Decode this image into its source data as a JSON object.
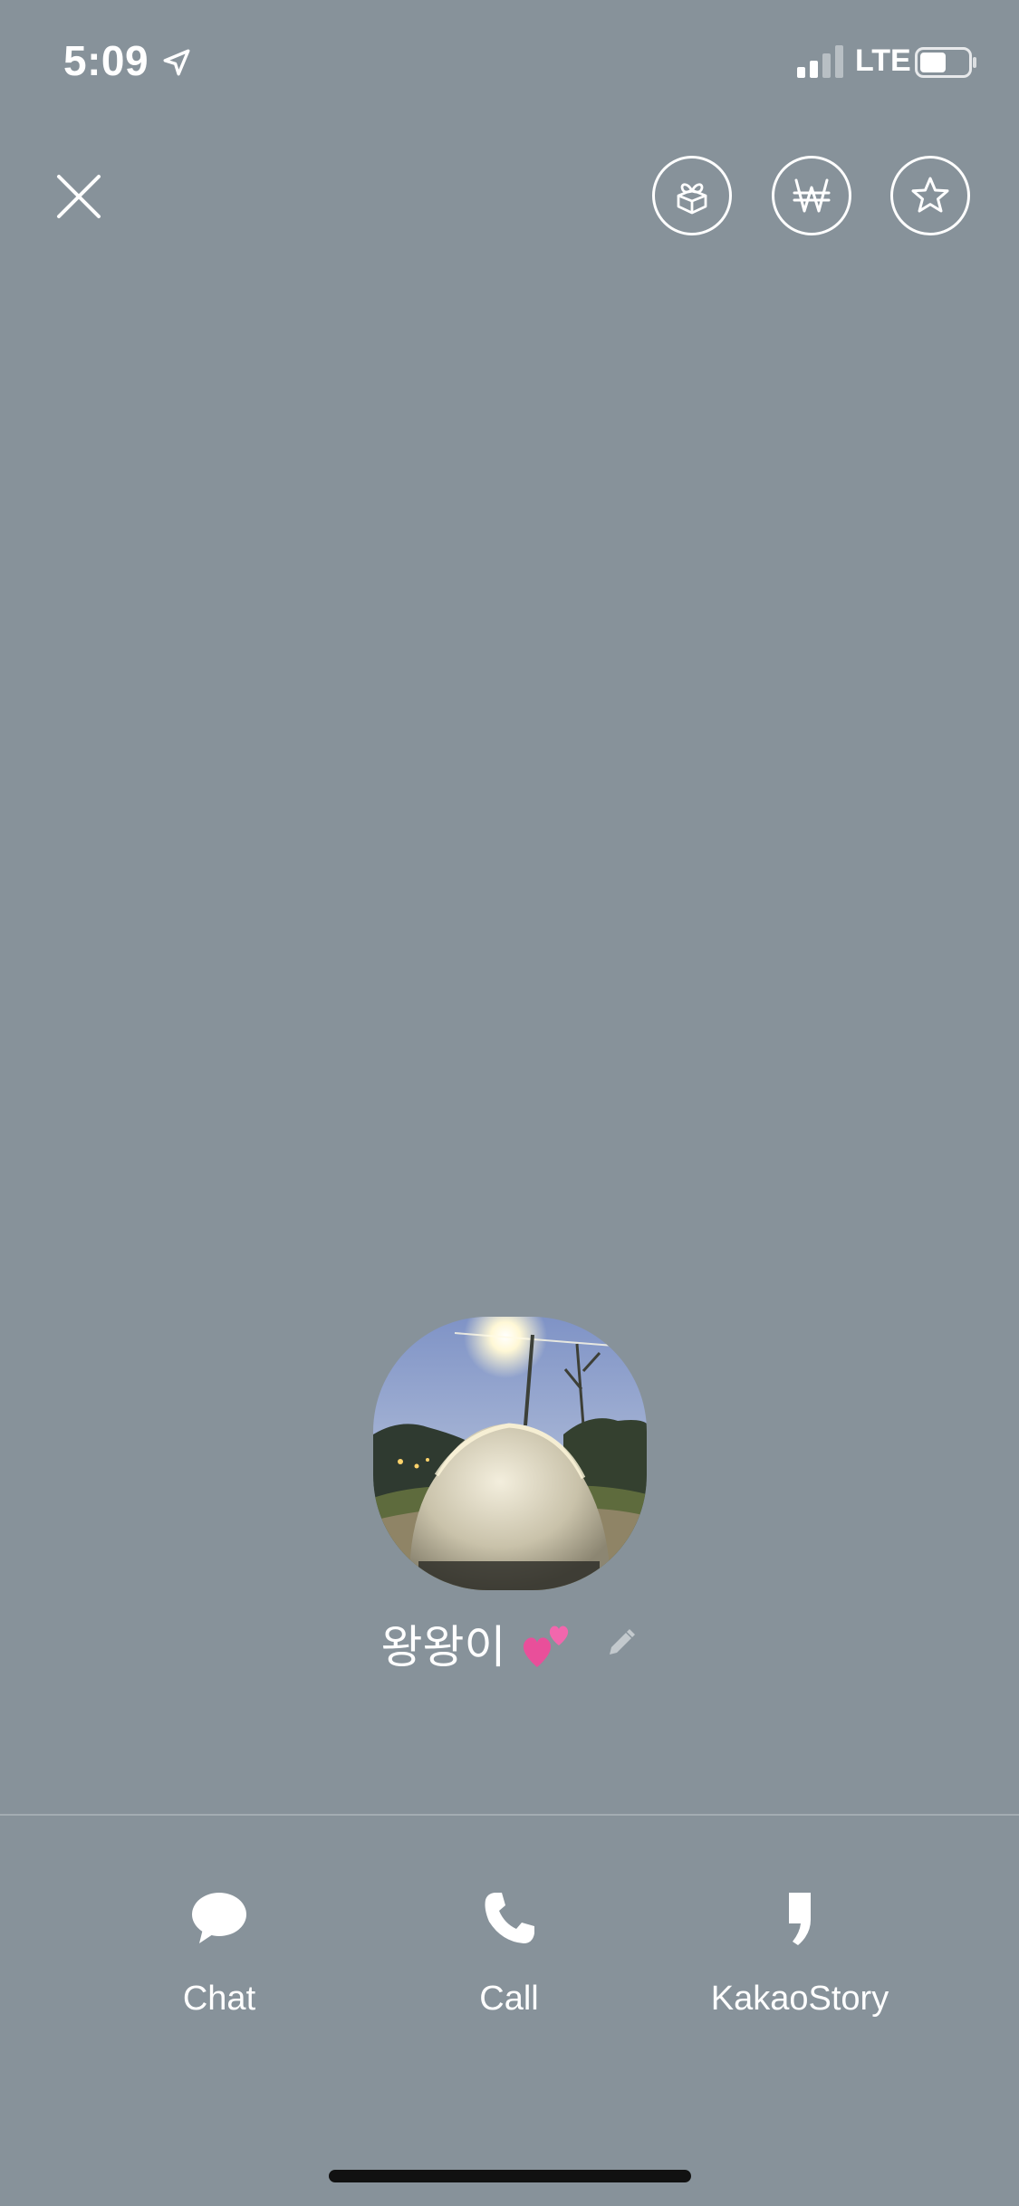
{
  "status_bar": {
    "time": "5:09",
    "network": "LTE",
    "icons": [
      "location-arrow-icon",
      "signal-icon",
      "battery-icon"
    ]
  },
  "top_bar": {
    "close_icon": "close-icon",
    "actions": [
      {
        "icon": "gift-icon"
      },
      {
        "icon": "won-icon"
      },
      {
        "icon": "star-icon"
      }
    ]
  },
  "profile": {
    "name": "왕왕이",
    "name_emoji": "💕",
    "edit_icon": "pencil-icon"
  },
  "actions": [
    {
      "label": "Chat",
      "icon": "speech-bubble-icon"
    },
    {
      "label": "Call",
      "icon": "phone-icon"
    },
    {
      "label": "KakaoStory",
      "icon": "kakaostory-icon"
    }
  ],
  "colors": {
    "background": "#87929A",
    "foreground": "#ffffff",
    "divider": "#a3acb2"
  }
}
